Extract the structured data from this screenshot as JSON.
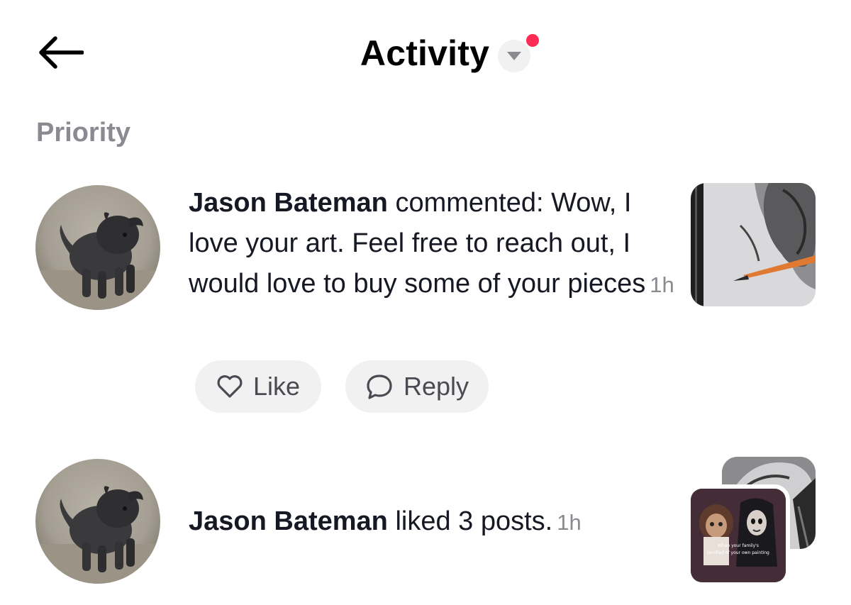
{
  "header": {
    "title": "Activity"
  },
  "section": {
    "label": "Priority"
  },
  "notifications": [
    {
      "user": "Jason Bateman",
      "text": " commented: Wow, I love your art. Feel free to reach out, I would love to buy some of your pieces",
      "time": "1h",
      "actions": {
        "like": "Like",
        "reply": "Reply"
      }
    },
    {
      "user": "Jason Bateman",
      "text": " liked 3 posts.",
      "time": "1h",
      "thumb_caption_line1": "When your family's",
      "thumb_caption_line2": "terrified of your own painting"
    }
  ],
  "colors": {
    "accent_dot": "#fe2c55",
    "pill_bg": "#f1f1f2",
    "muted_text": "#8a8b91"
  },
  "icons": [
    "back-arrow-icon",
    "chevron-down-icon",
    "heart-icon",
    "speech-bubble-icon"
  ]
}
